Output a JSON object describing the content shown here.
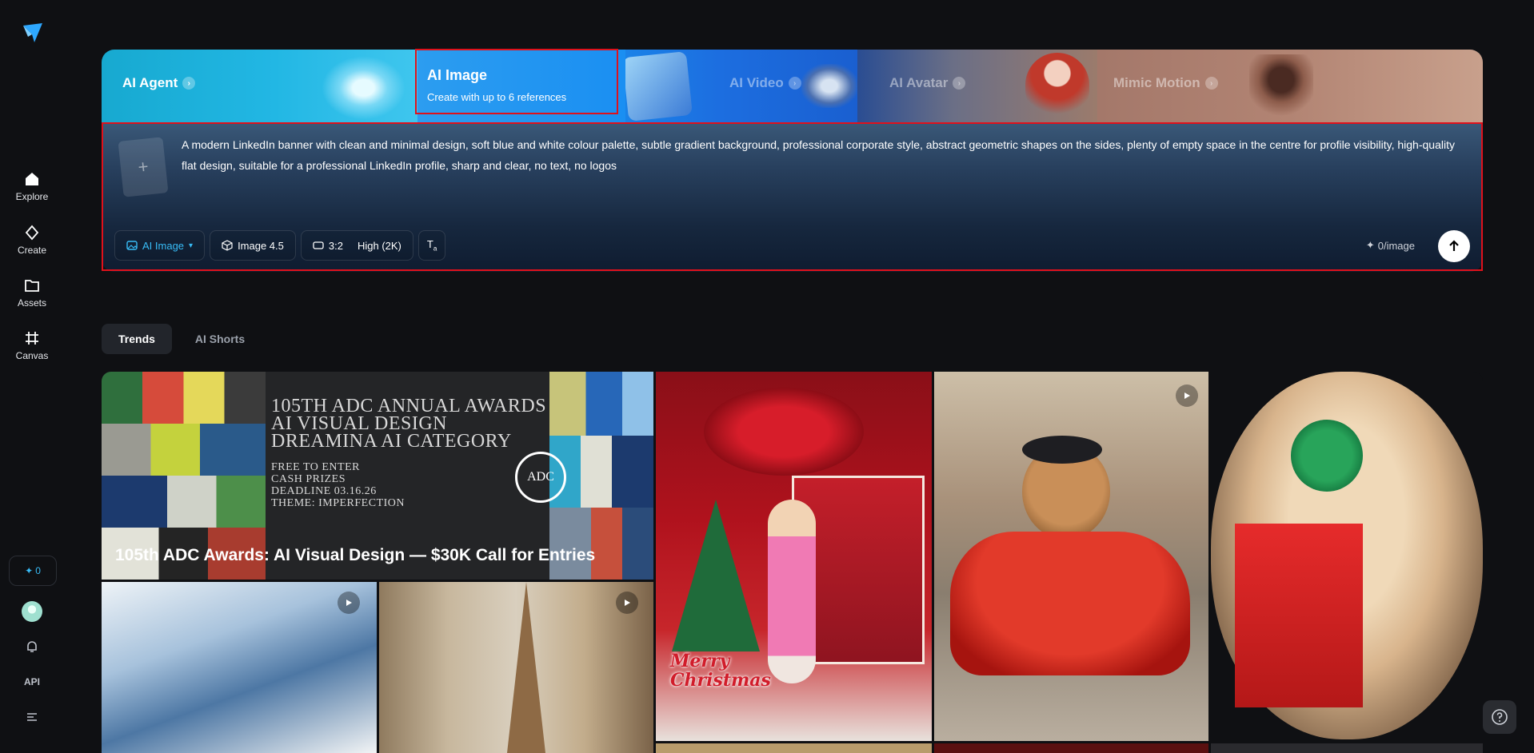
{
  "sidebar": {
    "items": [
      {
        "label": "Explore",
        "icon": "home-icon"
      },
      {
        "label": "Create",
        "icon": "diamond-icon"
      },
      {
        "label": "Assets",
        "icon": "folder-icon"
      },
      {
        "label": "Canvas",
        "icon": "canvas-icon"
      }
    ],
    "credits": "0",
    "api_label": "API"
  },
  "hero": {
    "tabs": {
      "agent": "AI Agent",
      "image_title": "AI Image",
      "image_sub": "Create with up to 6 references",
      "video": "AI Video",
      "avatar": "AI Avatar",
      "mimic": "Mimic Motion"
    },
    "prompt": "A modern LinkedIn banner with clean and minimal design, soft blue and white colour palette, subtle gradient background, professional corporate style, abstract geometric shapes on the sides, plenty of empty space in the centre for profile visibility, high-quality flat design, suitable for a professional LinkedIn profile, sharp and clear, no text, no logos",
    "toolbar": {
      "mode": "AI Image",
      "model": "Image 4.5",
      "ratio": "3:2",
      "quality": "High (2K)"
    },
    "cost": "0/image"
  },
  "feed": {
    "tabs": [
      "Trends",
      "AI Shorts"
    ],
    "banner": {
      "title": "105th ADC Awards: AI Visual Design — $30K Call for Entries",
      "lines_big": [
        "105TH ADC ANNUAL AWARDS",
        "AI VISUAL DESIGN",
        "DREAMINA AI CATEGORY"
      ],
      "lines_small": [
        "FREE TO ENTER",
        "CASH PRIZES",
        "DEADLINE 03.16.26",
        "THEME: IMPERFECTION"
      ],
      "mark": "ADC"
    },
    "christmas_text": "Merry Christmas"
  },
  "colors": {
    "accent": "#38bdf8",
    "highlight": "#e0111b",
    "bg": "#0f1013"
  }
}
